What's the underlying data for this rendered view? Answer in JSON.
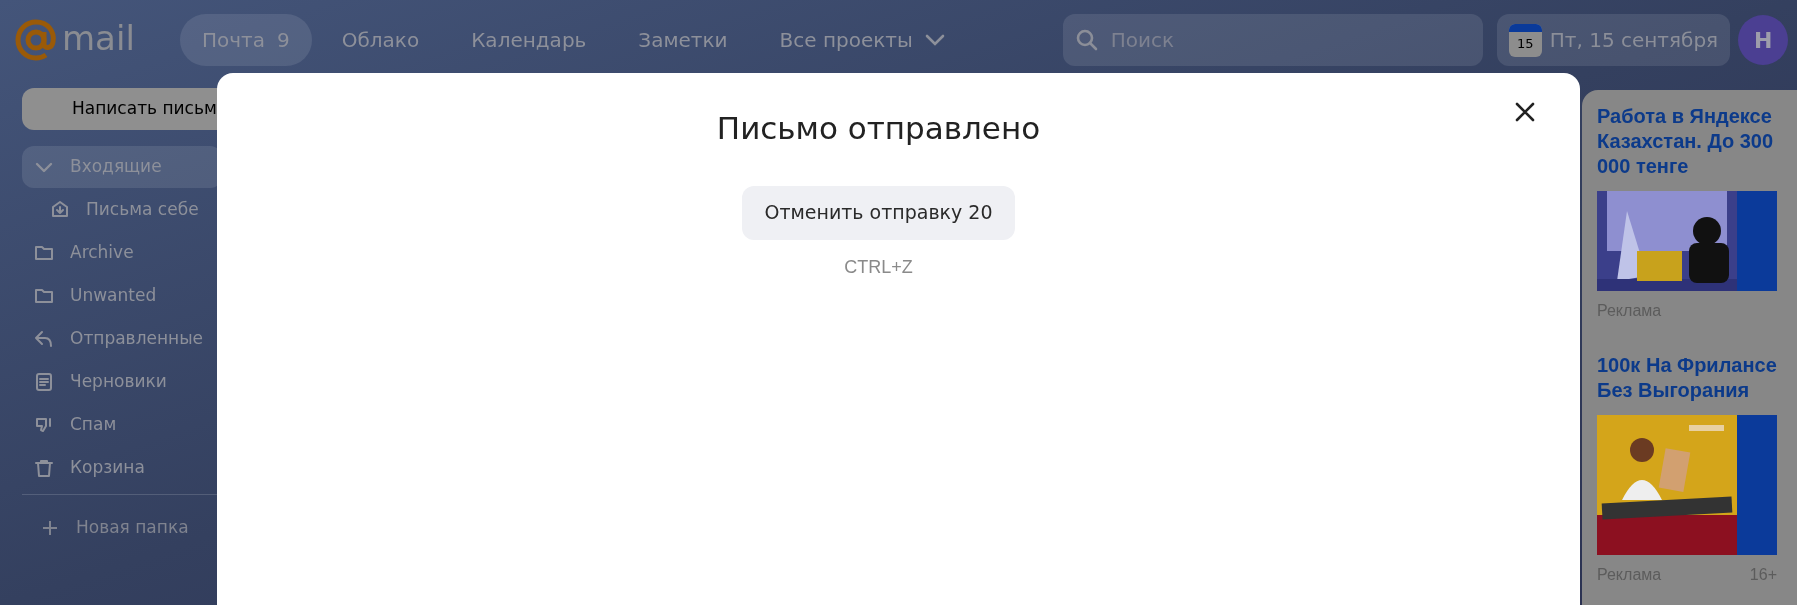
{
  "header": {
    "logo": "mail",
    "nav": [
      {
        "label": "Почта",
        "badge": "9",
        "selected": true
      },
      {
        "label": "Облако",
        "selected": false
      },
      {
        "label": "Календарь",
        "selected": false
      },
      {
        "label": "Заметки",
        "selected": false
      },
      {
        "label": "Все проекты",
        "selected": false,
        "dropdown": true
      }
    ],
    "search": {
      "placeholder": "Поиск"
    },
    "calendar_day": "15",
    "date": "Пт, 15 сентября",
    "avatar": "Н"
  },
  "sidebar": {
    "compose": "Написать письм",
    "folders": [
      {
        "label": "Входящие",
        "kind": "collapsible",
        "selected": true,
        "children": [
          {
            "label": "Письма себе",
            "kind": "inbox",
            "selected": false
          }
        ]
      },
      {
        "label": "Archive",
        "kind": "folder",
        "selected": false
      },
      {
        "label": "Unwanted",
        "kind": "folder",
        "selected": false
      },
      {
        "label": "Отправленные",
        "kind": "sent",
        "selected": false
      },
      {
        "label": "Черновики",
        "kind": "drafts",
        "selected": false
      },
      {
        "label": "Спам",
        "kind": "spam",
        "selected": false
      },
      {
        "label": "Корзина",
        "kind": "trash",
        "selected": false
      }
    ],
    "new_folder": "Новая папка"
  },
  "dialog": {
    "title": "Письмо отправлено",
    "undo_button": "Отменить отправку 20",
    "shortcut": "CTRL+Z"
  },
  "ads": [
    {
      "title": "Работа в Яндексе Казахстан. До 300 000 тенге",
      "label": "Реклама"
    },
    {
      "title": "100к На Фрилансе Без Выгорания",
      "label": "Реклама",
      "age": "16+"
    }
  ]
}
